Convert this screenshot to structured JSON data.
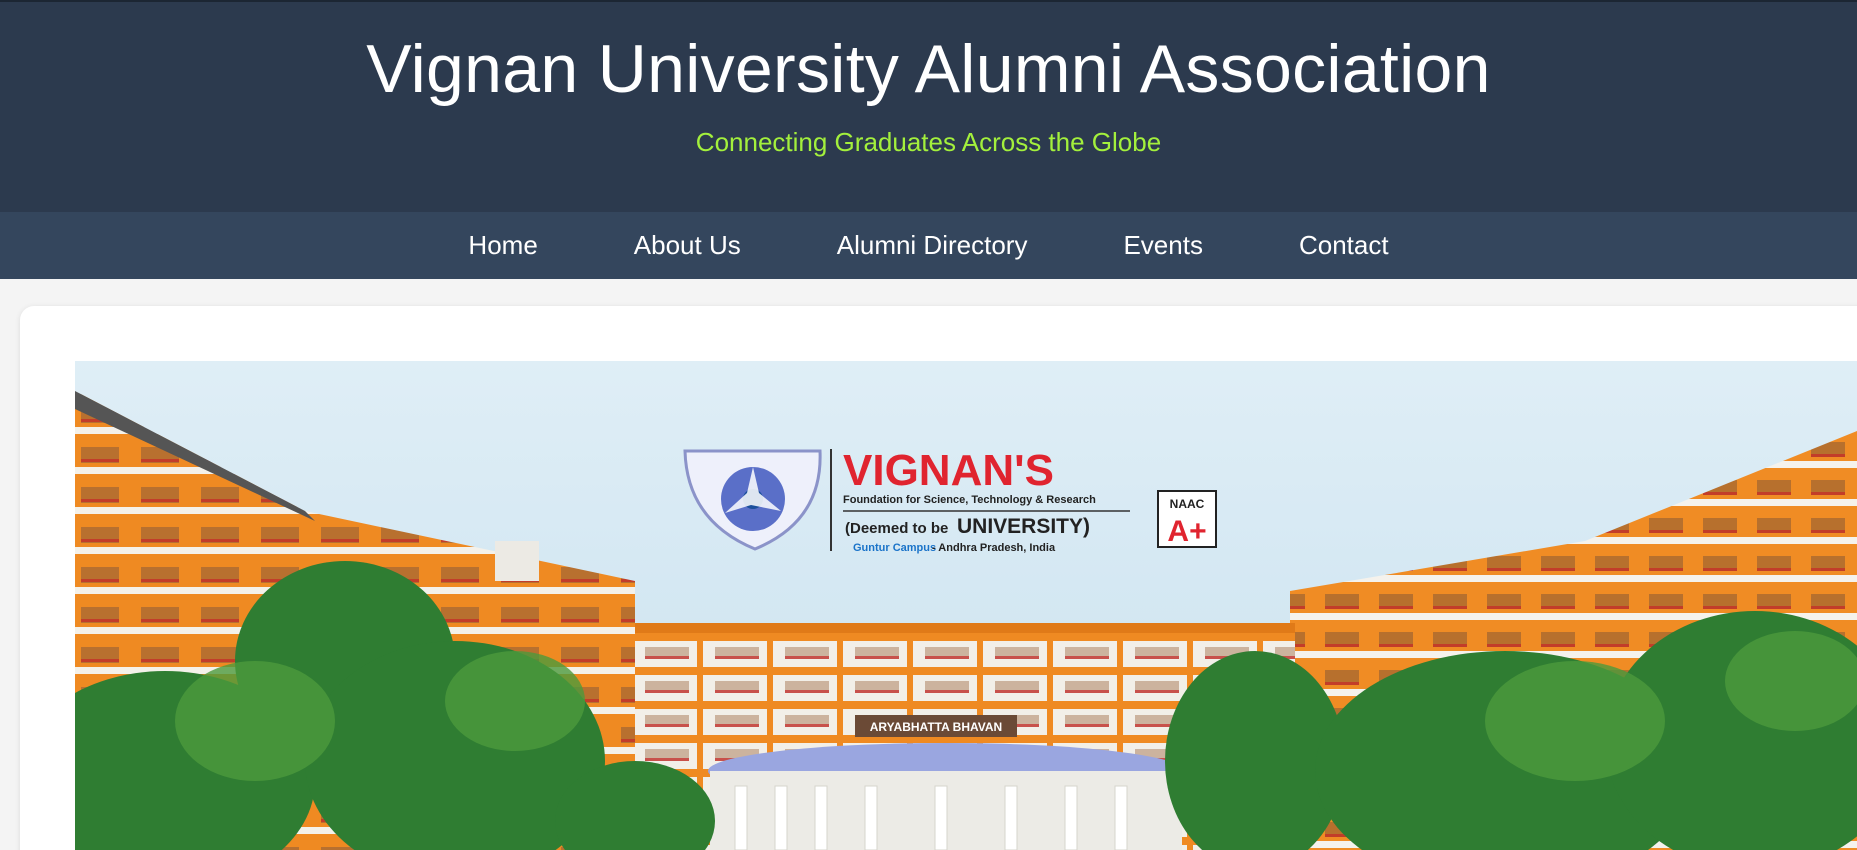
{
  "header": {
    "title": "Vignan University Alumni Association",
    "tagline": "Connecting Graduates Across the Globe"
  },
  "nav": {
    "items": [
      {
        "label": "Home"
      },
      {
        "label": "About Us"
      },
      {
        "label": "Alumni Directory"
      },
      {
        "label": "Events"
      },
      {
        "label": "Contact"
      }
    ]
  },
  "hero": {
    "brand_name": "VIGNAN'S",
    "brand_line": "Foundation for Science, Technology & Research",
    "deemed_prefix": "(Deemed to be",
    "deemed_university": "UNIVERSITY)",
    "campus_name": "Guntur Campus",
    "campus_location": " - Andhra Pradesh, India",
    "accreditation": "NAAC",
    "grade": "A+",
    "building_sign": "ARYABHATTA BHAVAN"
  },
  "colors": {
    "header_bg": "#2c3a4e",
    "nav_bg": "#34465d",
    "tagline": "#a3f03c",
    "brand_red": "#e0242f",
    "building_orange": "#f08a1c"
  }
}
